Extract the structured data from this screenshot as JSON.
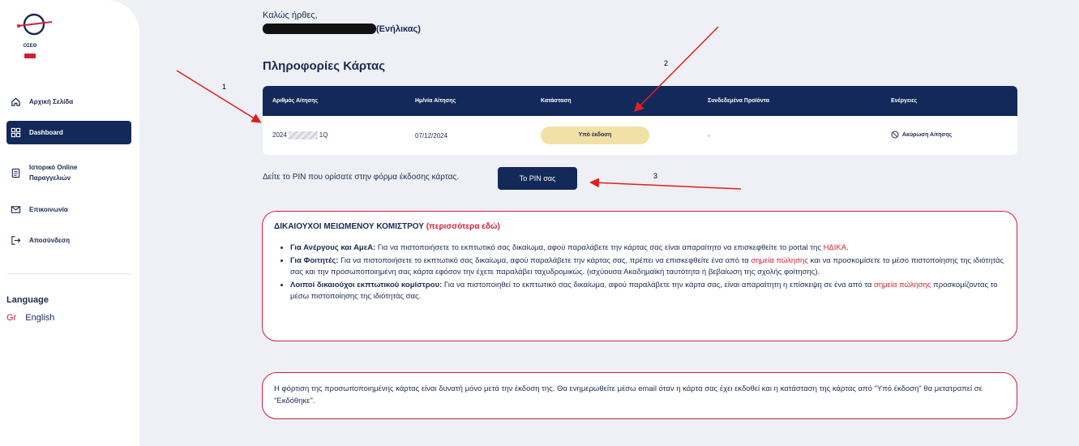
{
  "sidebar": {
    "logo": {
      "text": "ΟΣΕΘ"
    },
    "items": [
      {
        "label": "Αρχική Σελίδα",
        "icon": "home-icon"
      },
      {
        "label": "Dashboard",
        "icon": "dashboard-icon"
      },
      {
        "label": "Ιστορικό Online Παραγγελιών",
        "icon": "orders-icon"
      },
      {
        "label": "Επικοινωνία",
        "icon": "mail-icon"
      },
      {
        "label": "Αποσύνδεση",
        "icon": "logout-icon"
      }
    ],
    "language": {
      "title": "Language",
      "gr": "Gr",
      "en": "English"
    }
  },
  "header": {
    "welcome": "Καλώς ήρθες,",
    "user_suffix": "(Ενήλικας)"
  },
  "card_info": {
    "title": "Πληροφορίες Κάρτας",
    "columns": [
      "Αριθμός Αίτησης",
      "Ημ/νία Αίτησης",
      "Κατάσταση",
      "Συνδεδεμένα Προϊόντα",
      "Ενέργειες"
    ],
    "row": {
      "number_prefix": "2024",
      "number_suffix": "1Q",
      "date": "07/12/2024",
      "status": "Υπό έκδοση",
      "products": "-",
      "action": "Ακύρωση Αίτησης"
    }
  },
  "pin": {
    "text": "Δείτε το PIN που ορίσατε στην φόρμα έκδοσης κάρτας.",
    "button": "Το PIN σας"
  },
  "info_box": {
    "title": "ΔΙΚΑΙΟΥΧΟΙ ΜΕΙΩΜΕΝΟΥ ΚΟΜΙΣΤΡΟΥ",
    "title_link": "(περισσότερα εδώ)",
    "item1_bold": "Για Ανέργους και ΑμεΑ:",
    "item1_text": " Για να πιστοποιήσετε το εκπτωτικό σας δικαίωμα, αφού παραλάβετε την κάρτας σας είναι απαραίτητο να επισκεφθείτε το portal της ",
    "item1_link": "ΗΔΙΚΑ",
    "item1_end": ".",
    "item2_bold": "Για Φοιτητές:",
    "item2_text": " Για να πιστοποιήσετε το εκπτωτικό σας δικαίωμα, αφού παραλάβετε την κάρτας σας, πρέπει να επισκεφθείτε ένα από τα ",
    "item2_link": "σημεία πώλησης",
    "item2_end": " και να προσκομίσετε το μέσο πιστοποίησης της ιδιότητάς σας και την προσωποποιημένη σας κάρτα εφόσον την έχετε παραλάβει ταχυδρομικώς. (ισχύουσα Ακαδημαϊκή ταυτότητα ή βεβαίωση της σχολής φοίτησης).",
    "item3_bold": "Λοιποί δικαιούχοι εκπτωτικού κομίστρου:",
    "item3_text": " Για να πιστοποιηθεί το εκπτωτικό σας δικαίωμα, αφού παραλάβετε την κάρτα σας, είναι απαραίτητη η επίσκεψη σε ένα από τα ",
    "item3_link": "σημεία πώλησης",
    "item3_end": " προσκομίζοντας το μέσω πιστοποίησης της ιδιότητάς σας."
  },
  "note": "Η φόρτιση της προσωποποιημένης κάρτας είναι δυνατή μόνο μετά την έκδοση της. Θα ενημερωθείτε μέσω email όταν η κάρτα σας έχει εκδοθεί και η κατάσταση της κάρτας από \"Υπό έκδοση\" θα μετατραπεί σε \"Εκδόθηκε\".",
  "annotations": [
    "1",
    "2",
    "3"
  ],
  "colors": {
    "navy": "#13295a",
    "red": "#d0213a",
    "status": "#f1e1a4"
  }
}
